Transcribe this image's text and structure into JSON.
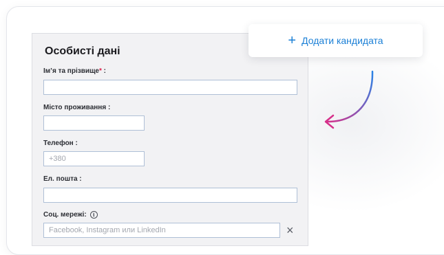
{
  "form": {
    "title": "Особисті дані",
    "fields": {
      "full_name": {
        "label": "Ім’я та прізвище",
        "required_mark": "*",
        "suffix": " :",
        "value": ""
      },
      "city": {
        "label": "Місто проживання",
        "suffix": " :",
        "value": ""
      },
      "phone": {
        "label": "Телефон",
        "suffix": " :",
        "placeholder": "+380"
      },
      "email": {
        "label": "Ел. пошта",
        "suffix": " :",
        "value": ""
      },
      "social": {
        "label": "Соц. мережі:",
        "info_icon": "i",
        "placeholder": "Facebook, Instagram или LinkedIn",
        "remove": "×"
      }
    }
  },
  "add_candidate": {
    "icon": "+",
    "label": "Додати кандидата"
  },
  "colors": {
    "accent": "#1a7fd6",
    "required": "#e0204a",
    "arrow_start": "#2b84e6",
    "arrow_end": "#d6308a"
  }
}
